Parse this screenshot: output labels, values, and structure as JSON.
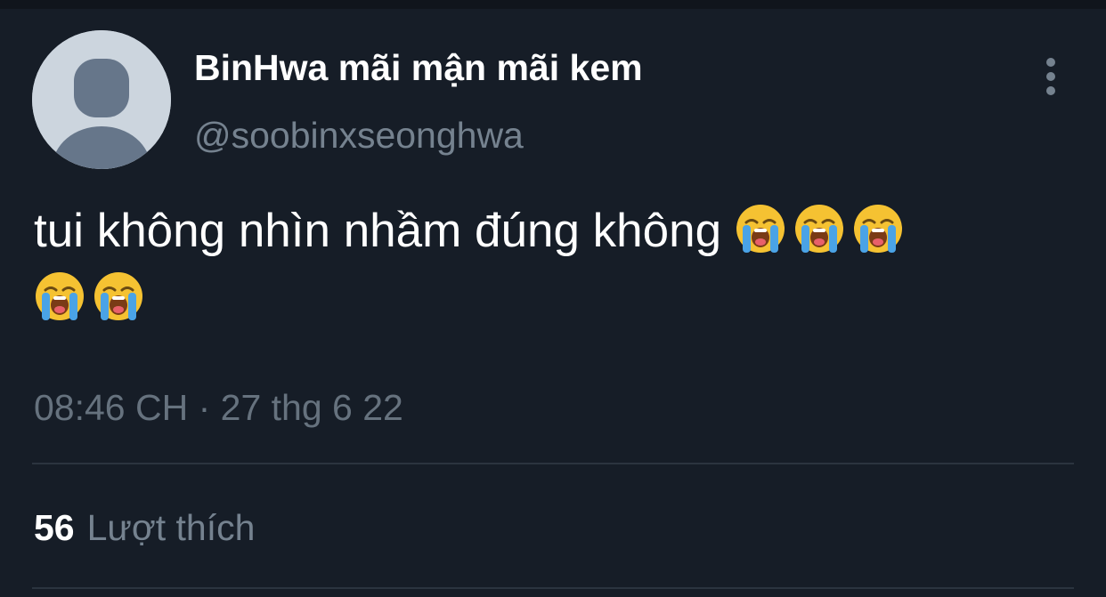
{
  "tweet": {
    "author": {
      "display_name": "BinHwa mãi mận mãi kem",
      "handle": "@soobinxseonghwa",
      "avatar_icon": "default-avatar-silhouette-icon"
    },
    "text": "tui không nhìn nhầm đúng không",
    "emojis": [
      "loudly-crying-face",
      "loudly-crying-face",
      "loudly-crying-face",
      "loudly-crying-face",
      "loudly-crying-face"
    ],
    "timestamp": "08:46 CH · 27 thg 6 22",
    "likes": {
      "count": "56",
      "label": "Lượt thích"
    },
    "more_icon": "vertical-ellipsis-icon"
  },
  "colors": {
    "background": "#161d27",
    "text_primary": "#ffffff",
    "text_secondary": "#75828f",
    "divider": "#2b343f",
    "avatar_bg": "#ccd5de",
    "avatar_silhouette": "#66768a"
  }
}
